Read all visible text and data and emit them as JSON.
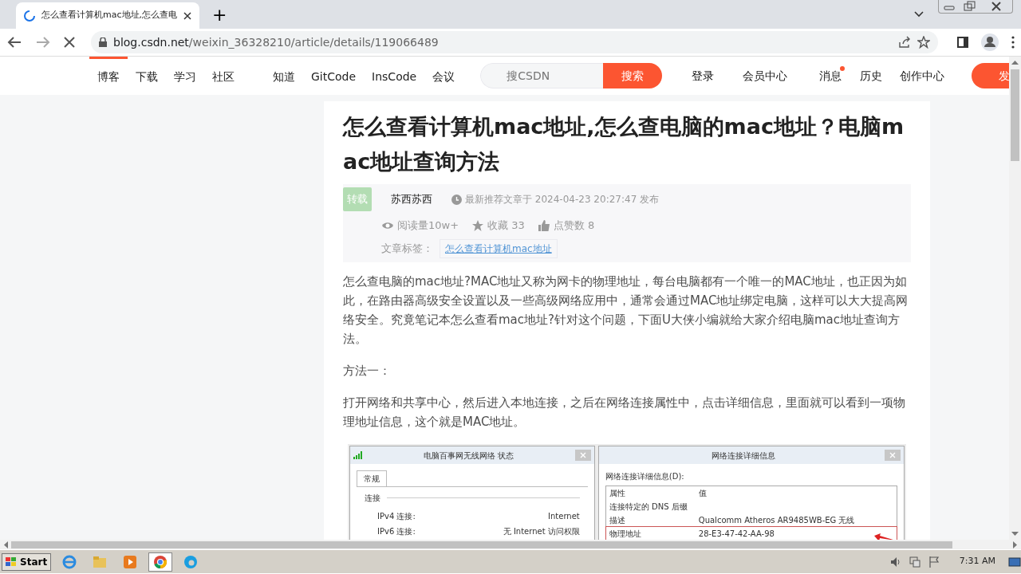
{
  "browser": {
    "tab": {
      "title": "怎么查看计算机mac地址,怎么查电",
      "loading": true
    },
    "new_tab": "+",
    "url": {
      "host": "blog.csdn.net",
      "path": "/weixin_36328210/article/details/119066489"
    }
  },
  "site_nav": {
    "links": [
      {
        "label": "博客",
        "selected": true
      },
      {
        "label": "下载",
        "selected": false
      },
      {
        "label": "学习",
        "selected": false
      },
      {
        "label": "社区",
        "selected": false
      },
      {
        "label": "知道",
        "selected": false
      },
      {
        "label": "GitCode",
        "selected": false
      },
      {
        "label": "InsCode",
        "selected": false
      },
      {
        "label": "会议",
        "selected": false
      }
    ],
    "search": {
      "placeholder": "搜CSDN",
      "button": "搜索"
    },
    "login": "登录",
    "right_links": [
      {
        "label": "会员中心",
        "badge": false
      },
      {
        "label": "消息",
        "badge": true
      },
      {
        "label": "历史",
        "badge": false
      },
      {
        "label": "创作中心",
        "badge": false
      }
    ],
    "publish": "发"
  },
  "article": {
    "title": "怎么查看计算机mac地址,怎么查电脑的mac地址？电脑mac地址查询方法",
    "repost_tag": "转载",
    "author": "苏西苏西",
    "published": "最新推荐文章于 2024-04-23 20:27:47 发布",
    "stats": [
      {
        "kind": "views",
        "text": "阅读量10w+"
      },
      {
        "kind": "favorites",
        "text": "收藏 33"
      },
      {
        "kind": "likes",
        "text": "点赞数 8"
      }
    ],
    "tags_label": "文章标签：",
    "tags": [
      "怎么查看计算机mac地址"
    ],
    "paragraphs": [
      "怎么查电脑的mac地址?MAC地址又称为网卡的物理地址，每台电脑都有一个唯一的MAC地址，也正因为如此，在路由器高级安全设置以及一些高级网络应用中，通常会通过MAC地址绑定电脑，这样可以大大提高网络安全。究竟笔记本怎么查看mac地址?针对这个问题，下面U大侠小编就给大家介绍电脑mac地址查询方法。",
      "方法一：",
      "打开网络和共享中心，然后进入本地连接，之后在网络连接属性中，点击详细信息，里面就可以看到一项物理地址信息，这个就是MAC地址。"
    ],
    "screenshot": {
      "status_dialog": {
        "title": "电脑百事网无线网络 状态",
        "tab": "常规",
        "section": "连接",
        "rows": [
          {
            "label": "IPv4 连接:",
            "value": "Internet"
          },
          {
            "label": "IPv6 连接:",
            "value": "无 Internet 访问权限"
          }
        ]
      },
      "details_dialog": {
        "title": "网络连接详细信息",
        "list_label": "网络连接详细信息(D):",
        "columns": [
          "属性",
          "值"
        ],
        "rows": [
          {
            "property": "连接特定的 DNS 后缀",
            "highlighted": false
          },
          {
            "property": "描述",
            "value": "Qualcomm Atheros AR9485WB-EG 无线",
            "highlighted": false
          },
          {
            "property": "物理地址",
            "value": "28-E3-47-42-AA-98",
            "highlighted": true
          }
        ]
      }
    }
  },
  "taskbar": {
    "start": "Start",
    "time": "7:31 AM"
  }
}
